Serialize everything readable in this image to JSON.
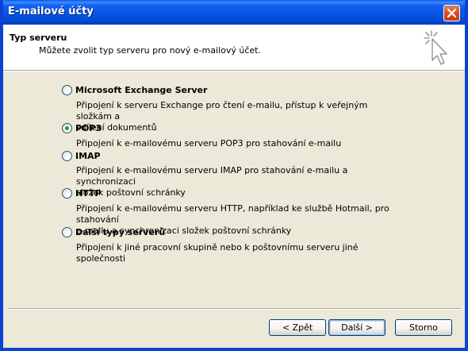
{
  "window": {
    "title": "E-mailové účty",
    "close_icon": "close-icon"
  },
  "header": {
    "title": "Typ serveru",
    "subtitle": "Můžete zvolit typ serveru pro nový e-mailový účet.",
    "icon": "wizard-sparkle-cursor-icon"
  },
  "options": [
    {
      "label": "Microsoft Exchange Server",
      "checked": false,
      "desc_lines": [
        "Připojení k serveru Exchange pro čtení e-mailu, přístup k veřejným složkám a",
        "sdílení dokumentů"
      ]
    },
    {
      "label": "POP3",
      "checked": true,
      "desc_lines": [
        "Připojení k e-mailovému serveru POP3 pro stahování e-mailu"
      ]
    },
    {
      "label": "IMAP",
      "checked": false,
      "desc_lines": [
        "Připojení k e-mailovému serveru IMAP pro stahování e-mailu a synchronizaci",
        "složek poštovní schránky"
      ]
    },
    {
      "label": "HTTP",
      "checked": false,
      "desc_lines": [
        "Připojení k e-mailovému serveru HTTP, například ke službě Hotmail, pro stahování",
        "e-mailu a synchronizaci složek poštovní schránky"
      ]
    },
    {
      "label": "Další typy serverů",
      "checked": false,
      "desc_lines": [
        "Připojení k jiné pracovní skupině nebo k poštovnímu serveru jiné společnosti"
      ]
    }
  ],
  "buttons": {
    "back": "< Zpět",
    "next": "Další >",
    "cancel": "Storno"
  },
  "colors": {
    "titlebar": "#0456E4",
    "dialog_bg": "#ECE9D8",
    "radio_checked": "#21A121"
  }
}
